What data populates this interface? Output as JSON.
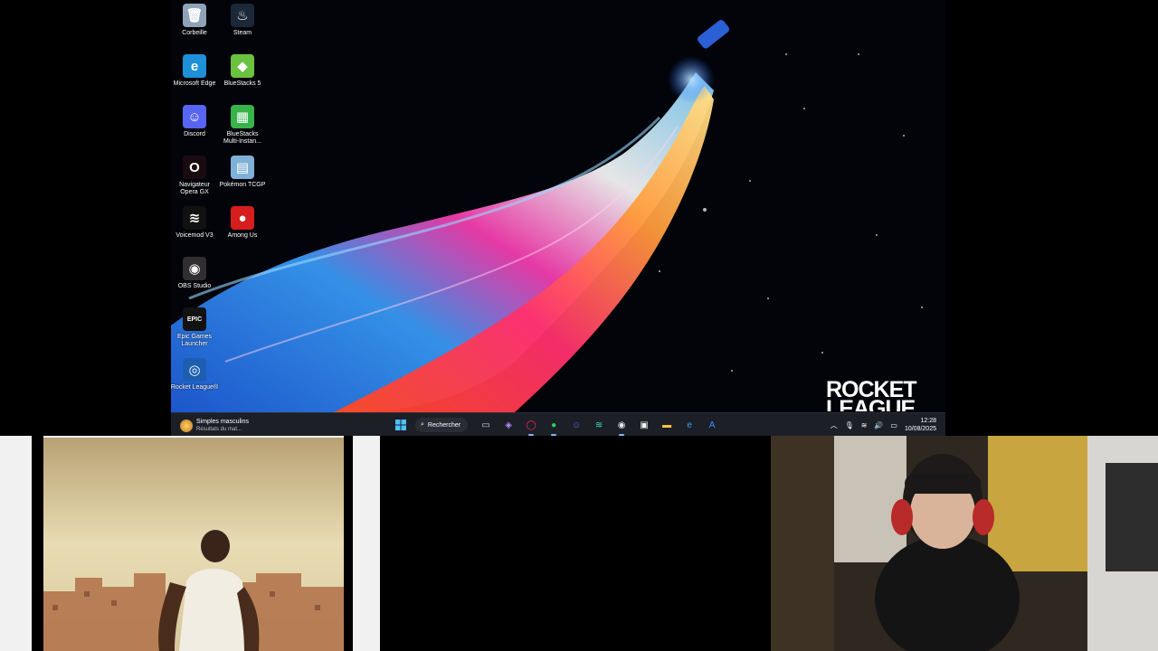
{
  "desktop_icons": [
    {
      "label": "Corbeille",
      "icon": "recycle-bin-icon",
      "col": 0,
      "row": 0,
      "bg": "#8fa3b8",
      "glyph": "🗑"
    },
    {
      "label": "Steam",
      "icon": "steam-icon",
      "col": 1,
      "row": 0,
      "bg": "#1b2838",
      "glyph": "♨"
    },
    {
      "label": "Microsoft Edge",
      "icon": "edge-icon",
      "col": 0,
      "row": 1,
      "bg": "#1e8fd8",
      "glyph": "e"
    },
    {
      "label": "BlueStacks 5",
      "icon": "bluestacks-icon",
      "col": 1,
      "row": 1,
      "bg": "#6ac240",
      "glyph": "◆"
    },
    {
      "label": "Discord",
      "icon": "discord-icon",
      "col": 0,
      "row": 2,
      "bg": "#5865f2",
      "glyph": "☺"
    },
    {
      "label": "BlueStacks Multi-Instan...",
      "icon": "bluestacks-multi-icon",
      "col": 1,
      "row": 2,
      "bg": "#37b34a",
      "glyph": "▦"
    },
    {
      "label": "Navigateur Opera GX",
      "icon": "opera-gx-icon",
      "col": 0,
      "row": 3,
      "bg": "#1a0b10",
      "glyph": "O"
    },
    {
      "label": "Pokémon TCGP",
      "icon": "pokemon-tcgp-icon",
      "col": 1,
      "row": 3,
      "bg": "#7fb0d6",
      "glyph": "▤"
    },
    {
      "label": "Voicemod V3",
      "icon": "voicemod-icon",
      "col": 0,
      "row": 4,
      "bg": "#111",
      "glyph": "≋"
    },
    {
      "label": "Among Us",
      "icon": "among-us-icon",
      "col": 1,
      "row": 4,
      "bg": "#d71e1e",
      "glyph": "●"
    },
    {
      "label": "OBS Studio",
      "icon": "obs-icon",
      "col": 0,
      "row": 5,
      "bg": "#302e31",
      "glyph": "◉"
    },
    {
      "label": "Epic Games Launcher",
      "icon": "epic-games-icon",
      "col": 0,
      "row": 6,
      "bg": "#121212",
      "glyph": "EPIC"
    },
    {
      "label": "Rocket League®",
      "icon": "rocket-league-icon",
      "col": 0,
      "row": 7,
      "bg": "#1c5fb0",
      "glyph": "◎"
    }
  ],
  "wallpaper": {
    "logo_line1": "ROCKET",
    "logo_line2": "LEAGUE"
  },
  "taskbar": {
    "widget_title": "Simples masculins",
    "widget_subtitle": "Résultats du mat...",
    "search_label": "Rechercher",
    "apps": [
      {
        "name": "task-view-icon",
        "glyph": "▭",
        "color": "#cfd3dc"
      },
      {
        "name": "copilot-icon",
        "glyph": "◈",
        "color": "#b18cff"
      },
      {
        "name": "opera-gx-taskbar-icon",
        "glyph": "◯",
        "color": "#ff2b55",
        "active": true
      },
      {
        "name": "spotify-icon",
        "glyph": "●",
        "color": "#1ed760",
        "active": true
      },
      {
        "name": "discord-taskbar-icon",
        "glyph": "☺",
        "color": "#5865f2"
      },
      {
        "name": "voicemod-taskbar-icon",
        "glyph": "≋",
        "color": "#3be3a8"
      },
      {
        "name": "obs-taskbar-icon",
        "glyph": "◉",
        "color": "#e6e6e6",
        "active": true
      },
      {
        "name": "store-icon",
        "glyph": "▣",
        "color": "#f3f3f3"
      },
      {
        "name": "file-explorer-icon",
        "glyph": "▬",
        "color": "#f6c344"
      },
      {
        "name": "edge-taskbar-icon",
        "glyph": "e",
        "color": "#2fa4ea"
      },
      {
        "name": "app-icon",
        "glyph": "A",
        "color": "#3d8bff"
      }
    ],
    "clock_time": "12:28",
    "clock_date": "10/08/2025"
  }
}
